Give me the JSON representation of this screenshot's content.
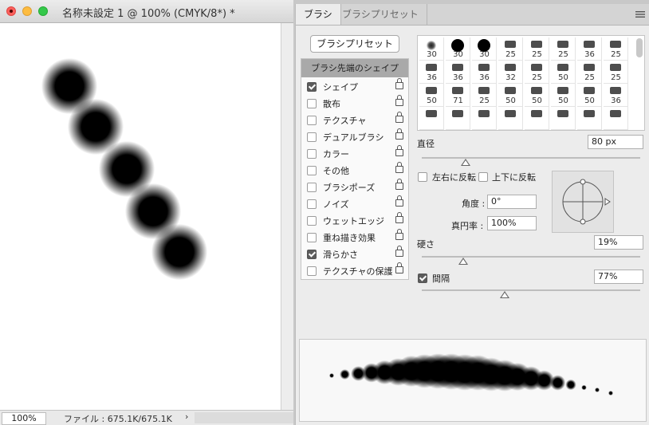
{
  "document": {
    "title": "名称未設定 1 @ 100% (CMYK/8*) *",
    "zoom": "100%",
    "file_info": "ファイル : 675.1K/675.1K",
    "status_arrow": "›"
  },
  "panel": {
    "tabs": [
      {
        "label": "ブラシ",
        "active": true
      },
      {
        "label": "ブラシプリセット",
        "active": false
      }
    ],
    "menu_icon": "panel-menu-icon",
    "preset_button": "ブラシプリセット",
    "options_header": "ブラシ先端のシェイプ",
    "options": [
      {
        "label": "シェイプ",
        "checked": true
      },
      {
        "label": "散布",
        "checked": false
      },
      {
        "label": "テクスチャ",
        "checked": false
      },
      {
        "label": "デュアルブラシ",
        "checked": false
      },
      {
        "label": "カラー",
        "checked": false
      },
      {
        "label": "その他",
        "checked": false
      },
      {
        "label": "ブラシポーズ",
        "checked": false
      },
      {
        "label": "ノイズ",
        "checked": false
      },
      {
        "label": "ウェットエッジ",
        "checked": false
      },
      {
        "label": "重ね描き効果",
        "checked": false
      },
      {
        "label": "滑らかさ",
        "checked": true
      },
      {
        "label": "テクスチャの保護",
        "checked": false
      }
    ],
    "brush_tips": [
      {
        "size": "30",
        "kind": "soft"
      },
      {
        "size": "30",
        "kind": "round"
      },
      {
        "size": "30",
        "kind": "round"
      },
      {
        "size": "25",
        "kind": "tip"
      },
      {
        "size": "25",
        "kind": "tip"
      },
      {
        "size": "25",
        "kind": "tip"
      },
      {
        "size": "36",
        "kind": "tip"
      },
      {
        "size": "25",
        "kind": "tip"
      },
      {
        "size": "36",
        "kind": "tip"
      },
      {
        "size": "36",
        "kind": "tip"
      },
      {
        "size": "36",
        "kind": "tip"
      },
      {
        "size": "32",
        "kind": "tip"
      },
      {
        "size": "25",
        "kind": "tip"
      },
      {
        "size": "50",
        "kind": "tip"
      },
      {
        "size": "25",
        "kind": "tip"
      },
      {
        "size": "25",
        "kind": "tip"
      },
      {
        "size": "50",
        "kind": "tip"
      },
      {
        "size": "71",
        "kind": "tip"
      },
      {
        "size": "25",
        "kind": "tip"
      },
      {
        "size": "50",
        "kind": "tip"
      },
      {
        "size": "50",
        "kind": "tip"
      },
      {
        "size": "50",
        "kind": "tip"
      },
      {
        "size": "50",
        "kind": "tip"
      },
      {
        "size": "36",
        "kind": "tip"
      },
      {
        "size": "",
        "kind": "tip"
      },
      {
        "size": "",
        "kind": "tip"
      },
      {
        "size": "",
        "kind": "tip"
      },
      {
        "size": "",
        "kind": "tip"
      },
      {
        "size": "",
        "kind": "tip"
      },
      {
        "size": "",
        "kind": "tip"
      },
      {
        "size": "",
        "kind": "tip"
      },
      {
        "size": "",
        "kind": "tip"
      }
    ],
    "diameter": {
      "label": "直径",
      "value": "80 px",
      "slider": 0.2
    },
    "flip_x": {
      "label": "左右に反転",
      "checked": false
    },
    "flip_y": {
      "label": "上下に反転",
      "checked": false
    },
    "angle": {
      "label": "角度 :",
      "value": "0°"
    },
    "roundness": {
      "label": "真円率 :",
      "value": "100%"
    },
    "hardness": {
      "label": "硬さ",
      "value": "19%",
      "slider": 0.19
    },
    "spacing": {
      "label": "間隔",
      "value": "77%",
      "checked": true,
      "slider": 0.38
    }
  }
}
